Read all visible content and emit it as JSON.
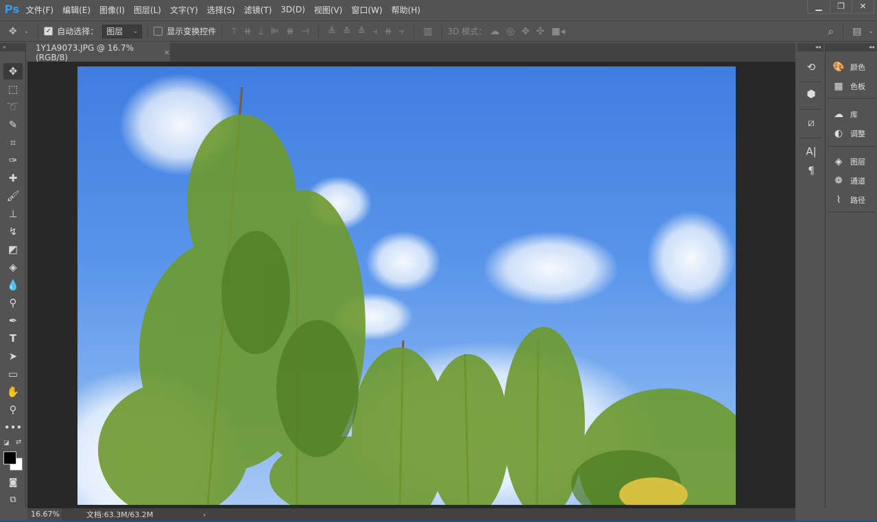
{
  "app": {
    "logo": "Ps",
    "accent": "#31a8ff"
  },
  "menu": [
    "文件(F)",
    "编辑(E)",
    "图像(I)",
    "图层(L)",
    "文字(Y)",
    "选择(S)",
    "滤镜(T)",
    "3D(D)",
    "视图(V)",
    "窗口(W)",
    "帮助(H)"
  ],
  "window_controls": {
    "minimize": "▁",
    "restore": "❐",
    "close": "✕"
  },
  "options": {
    "auto_select_label": "自动选择：",
    "auto_select_checked": true,
    "auto_select_target": "图层",
    "show_transform_label": "显示变换控件",
    "show_transform_checked": false,
    "mode_3d_label": "3D 模式："
  },
  "document": {
    "tab_title": "1Y1A9073.JPG @ 16.7%(RGB/8)",
    "close": "×"
  },
  "status": {
    "zoom": "16.67%",
    "doc_info": "文档:63.3M/63.2M",
    "arrow": "›"
  },
  "right_panels": [
    {
      "label": "颜色",
      "icon": "palette-icon"
    },
    {
      "label": "色板",
      "icon": "swatches-icon"
    },
    {
      "label": "库",
      "icon": "libraries-icon"
    },
    {
      "label": "调整",
      "icon": "adjustments-icon"
    },
    {
      "label": "图层",
      "icon": "layers-icon"
    },
    {
      "label": "通道",
      "icon": "channels-icon"
    },
    {
      "label": "路径",
      "icon": "paths-icon"
    }
  ],
  "colors": {
    "foreground": "#000000",
    "background": "#ffffff"
  }
}
